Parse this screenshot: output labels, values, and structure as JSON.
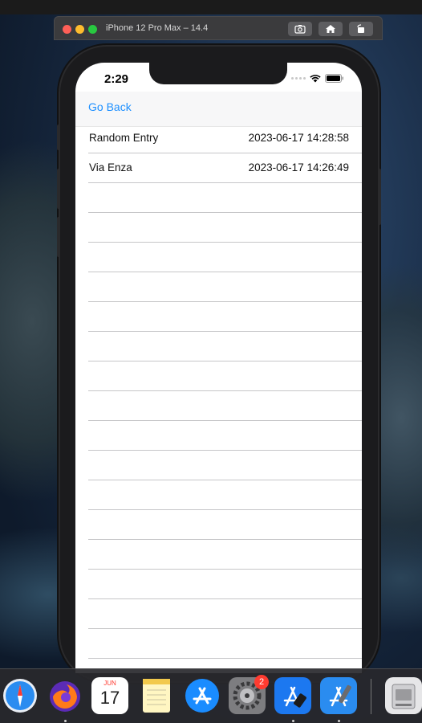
{
  "simulator": {
    "title": "iPhone 12 Pro Max – 14.4"
  },
  "status_bar": {
    "time": "2:29"
  },
  "navbar": {
    "back_label": "Go Back"
  },
  "entries": [
    {
      "name": "Random Entry",
      "timestamp": "2023-06-17 14:28:58"
    },
    {
      "name": "Via Enza",
      "timestamp": "2023-06-17 14:26:49"
    }
  ],
  "dock": {
    "calendar_month": "JUN",
    "calendar_day": "17",
    "preferences_badge": "2",
    "icons": [
      "safari-icon",
      "firefox-icon",
      "calendar-icon",
      "notes-icon",
      "app-store-icon",
      "system-preferences-icon",
      "xcode-instruments-icon",
      "xcode-icon",
      "disk-utility-icon"
    ]
  },
  "colors": {
    "link": "#1e90ff",
    "separator": "#c6c6c8",
    "badge": "#ff3b30"
  }
}
